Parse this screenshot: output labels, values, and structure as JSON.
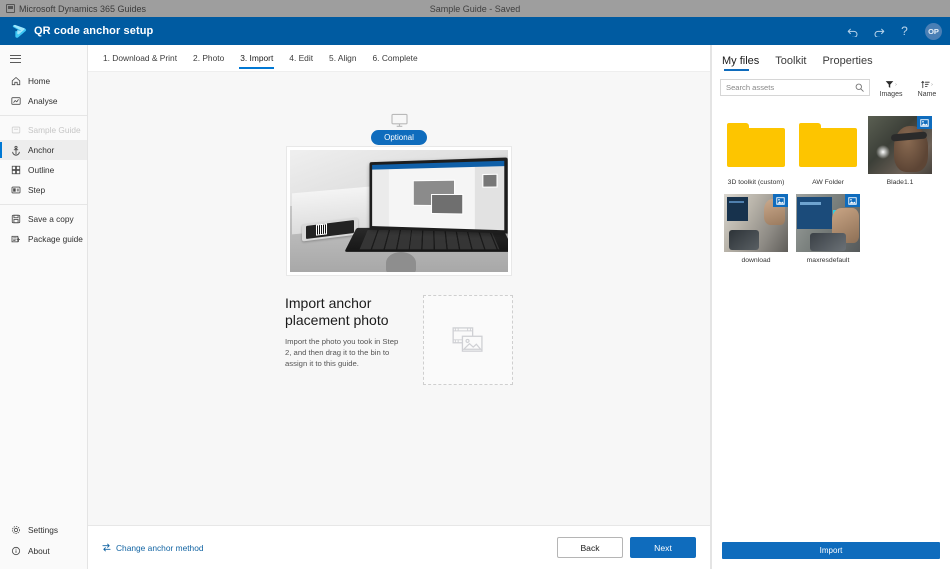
{
  "window": {
    "os_title_center": "Sample Guide - Saved",
    "os_title_left": "Microsoft Dynamics 365 Guides",
    "app_icon": "app-window-icon"
  },
  "appbar": {
    "title": "QR code anchor setup",
    "logo": "dynamics-guides-logo",
    "actions": [
      {
        "name": "undo-icon",
        "glyph": "↶"
      },
      {
        "name": "redo-icon",
        "glyph": "↷"
      },
      {
        "name": "help-icon",
        "glyph": "?"
      }
    ],
    "avatar_initials": "OP"
  },
  "sidebar": {
    "menu_toggle": "hamburger-icon",
    "groups": [
      {
        "items": [
          {
            "label": "Home",
            "icon": "home-icon",
            "state": "default"
          },
          {
            "label": "Analyse",
            "icon": "analyse-icon",
            "state": "default"
          }
        ]
      },
      {
        "items": [
          {
            "label": "Sample Guide",
            "icon": "guide-icon",
            "state": "disabled"
          },
          {
            "label": "Anchor",
            "icon": "anchor-icon",
            "state": "active"
          },
          {
            "label": "Outline",
            "icon": "outline-icon",
            "state": "default"
          },
          {
            "label": "Step",
            "icon": "step-icon",
            "state": "default"
          }
        ]
      },
      {
        "items": [
          {
            "label": "Save a copy",
            "icon": "save-copy-icon",
            "state": "default"
          },
          {
            "label": "Package guide",
            "icon": "package-guide-icon",
            "state": "default"
          }
        ]
      }
    ],
    "bottom_items": [
      {
        "label": "Settings",
        "icon": "gear-icon"
      },
      {
        "label": "About",
        "icon": "info-icon"
      }
    ]
  },
  "steps": [
    {
      "label": "1. Download & Print",
      "active": false
    },
    {
      "label": "2. Photo",
      "active": false
    },
    {
      "label": "3. Import",
      "active": true
    },
    {
      "label": "4. Edit",
      "active": false
    },
    {
      "label": "5. Align",
      "active": false
    },
    {
      "label": "6. Complete",
      "active": false
    }
  ],
  "main": {
    "device_icon": "monitor-icon",
    "badge": "Optional",
    "hero_image_alt": "laptop-on-desk-photo",
    "title": "Import anchor placement photo",
    "description": "Import the photo you took in Step 2, and then drag it to the bin to assign it to this guide.",
    "dropzone_icon": "media-placeholder-icon"
  },
  "footer": {
    "change_link": "Change anchor method",
    "change_icon": "swap-icon",
    "back_label": "Back",
    "next_label": "Next"
  },
  "rightpanel": {
    "tabs": [
      {
        "label": "My files",
        "active": true
      },
      {
        "label": "Toolkit",
        "active": false
      },
      {
        "label": "Properties",
        "active": false
      }
    ],
    "search": {
      "placeholder": "Search assets",
      "value": "",
      "icon": "search-icon"
    },
    "toolbar": [
      {
        "label": "Images",
        "icon": "filter-icon",
        "caret": "›"
      },
      {
        "label": "Name",
        "icon": "sort-icon",
        "caret": "›"
      }
    ],
    "files": [
      {
        "name": "3D toolkit (custom)",
        "type": "folder",
        "badge": null
      },
      {
        "name": "AW Folder",
        "type": "folder",
        "badge": null
      },
      {
        "name": "Blade1.1",
        "type": "image",
        "badge": "image-badge-icon",
        "style": "p-blade"
      },
      {
        "name": "download",
        "type": "image",
        "badge": "image-badge-icon",
        "style": "p-dl"
      },
      {
        "name": "maxresdefault",
        "type": "image",
        "badge": "image-badge-icon",
        "style": "p-mx"
      }
    ],
    "import_label": "Import"
  },
  "colors": {
    "appbar": "#005ba1",
    "accent": "#0f6cbd",
    "canvas": "#f7f7f7",
    "folder": "#fdc500",
    "titlebar": "#9e9e9e"
  }
}
